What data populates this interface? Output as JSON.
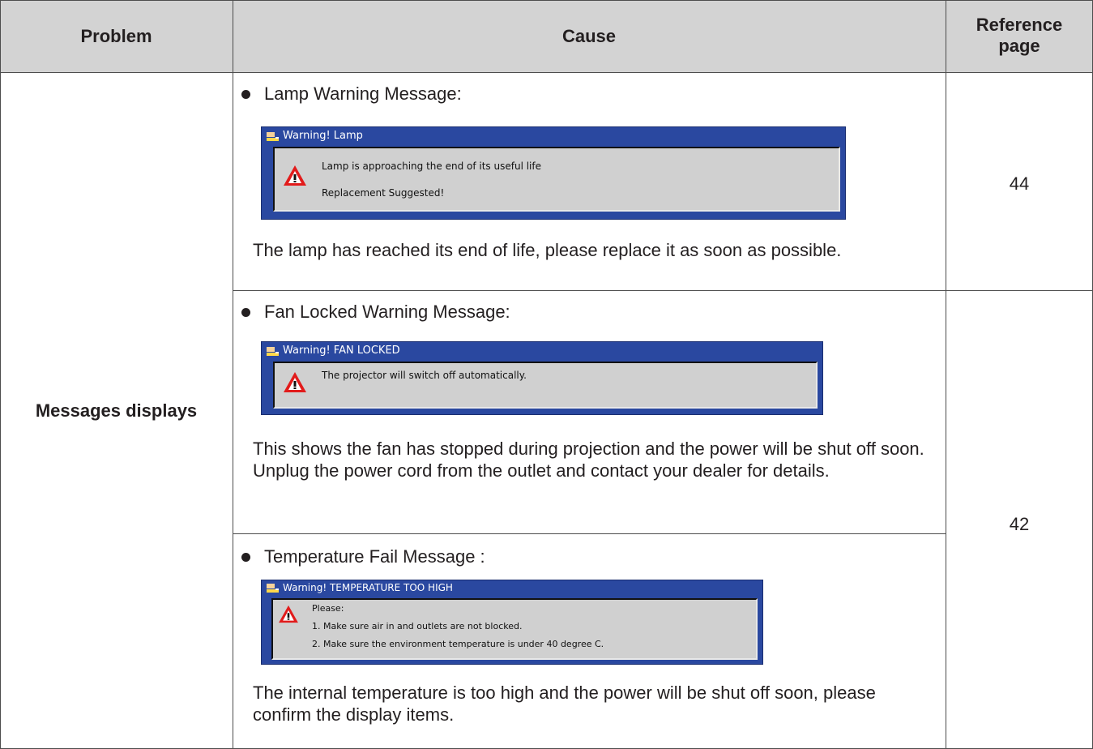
{
  "header": {
    "problem": "Problem",
    "cause": "Cause",
    "reference_page": "Reference page"
  },
  "problem_cell": "Messages displays",
  "rows": [
    {
      "bullet": "Lamp Warning Message:",
      "window_title": "Warning! Lamp",
      "window_lines": [
        "Lamp is approaching the end of its useful life",
        "Replacement Suggested!"
      ],
      "description": "The lamp has reached its end of life, please replace it as soon as possible.",
      "reference": "44"
    },
    {
      "bullet": "Fan Locked Warning Message:",
      "window_title": "Warning! FAN LOCKED",
      "window_lines": [
        "The projector will switch off automatically."
      ],
      "description": "This shows the fan has stopped during projection and the power will be shut off soon. Unplug the power cord from the outlet and contact your dealer for details.",
      "reference": "42"
    },
    {
      "bullet": "Temperature Fail Message :",
      "window_title": "Warning! TEMPERATURE TOO HIGH",
      "window_lines": [
        "Please:",
        "1. Make sure air in and outlets are not blocked.",
        "2. Make sure the environment temperature is under 40 degree C."
      ],
      "description": "The internal temperature is too high and the power will be shut off soon, please confirm the display items."
    }
  ],
  "colors": {
    "header_bg": "#d3d3d3",
    "window_frame": "#2a48a0",
    "window_body": "#d0d0d0",
    "warning_red": "#e21b1b"
  },
  "icons": [
    "bullet-dot-icon",
    "projector-window-icon",
    "warning-triangle-icon"
  ]
}
